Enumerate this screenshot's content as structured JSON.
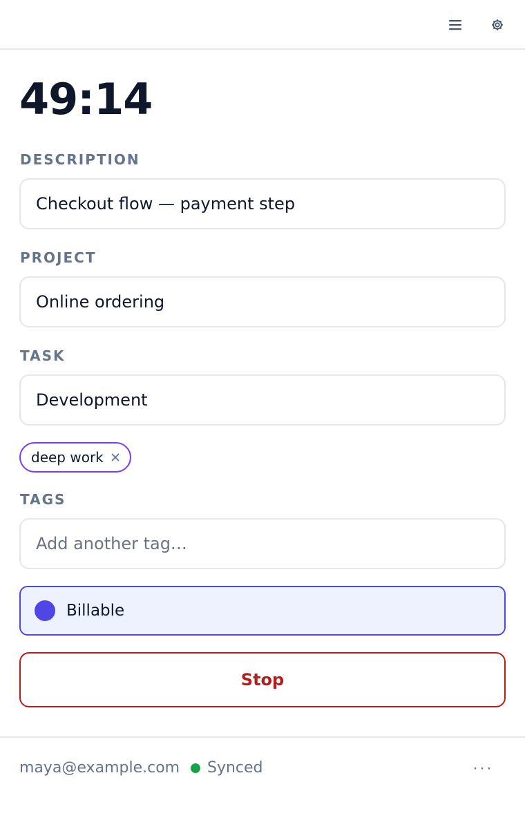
{
  "toolbar": {
    "menu_icon": "menu-icon",
    "settings_icon": "gear-icon"
  },
  "timer": {
    "display": "49:14"
  },
  "form": {
    "description_label": "DESCRIPTION",
    "description_value": "Checkout flow — payment step",
    "project_label": "PROJECT",
    "project_value": "Online ordering",
    "task_label": "TASK",
    "task_value": "Development",
    "tags": [
      {
        "label": "deep work"
      }
    ],
    "tags_label": "TAGS",
    "tags_placeholder": "Add another tag…",
    "billable_label": "Billable",
    "billable_on": true,
    "stop_label": "Stop"
  },
  "footer": {
    "email": "maya@example.com",
    "sync_status": "Synced",
    "more_label": "···"
  },
  "colors": {
    "accent": "#4f46e5",
    "accent_bg": "#eef2ff",
    "tag_border": "#7c3aed",
    "stop": "#b91c1c",
    "synced": "#16a34a",
    "muted": "#64748b",
    "border": "#e5e7eb"
  }
}
